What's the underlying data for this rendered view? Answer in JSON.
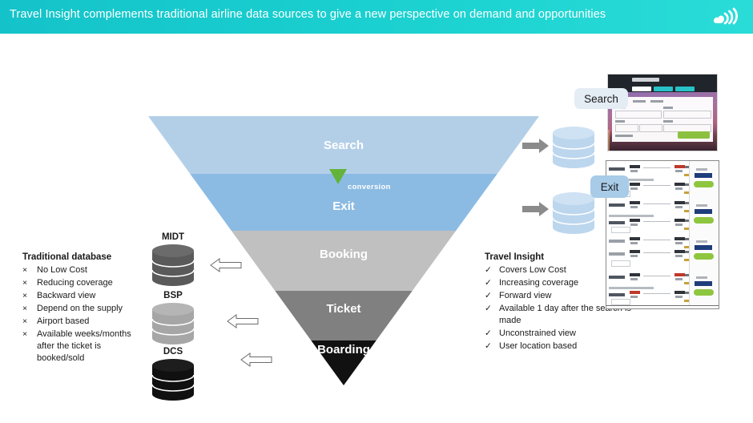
{
  "header": {
    "title": "Travel Insight complements traditional airline data sources to give a new perspective on demand and opportunities",
    "logo_icon": "skyscanner-cloud-wifi-logo",
    "bg_start": "#14c3c9",
    "bg_end": "#2adcd8"
  },
  "funnel": {
    "bands": [
      {
        "label": "Search",
        "color": "#b3cfe8"
      },
      {
        "label": "Exit",
        "color": "#8bbbe3"
      },
      {
        "label": "Booking",
        "color": "#c0c0c0"
      },
      {
        "label": "Ticket",
        "color": "#808080"
      },
      {
        "label": "Boarding",
        "color": "#111111"
      }
    ],
    "conversion_label": "conversion",
    "conversion_color": "#63b33b"
  },
  "left_panel": {
    "title": "Traditional database",
    "bullet_mark": "×",
    "items": [
      "No Low Cost",
      "Reducing coverage",
      "Backward view",
      "Depend on the supply",
      "Airport based",
      "Available weeks/months after the ticket is booked/sold"
    ]
  },
  "right_panel": {
    "title": "Travel Insight",
    "bullet_mark": "✓",
    "items": [
      "Covers Low Cost",
      "Increasing coverage",
      "Forward view",
      "Available 1 day after the search is made",
      "Unconstrained view",
      "User location based"
    ]
  },
  "databases": [
    {
      "label": "MIDT",
      "color": "#5a5a5a"
    },
    {
      "label": "BSP",
      "color": "#a6a6a6"
    },
    {
      "label": "DCS",
      "color": "#101010"
    }
  ],
  "insight_stores": [
    {
      "name": "search-data-store",
      "color": "#bcd6ee"
    },
    {
      "name": "exit-data-store",
      "color": "#bcd6ee"
    }
  ],
  "callouts": [
    {
      "label": "Search",
      "bg": "#e4ecf4"
    },
    {
      "label": "Exit",
      "bg": "#a8cbe8"
    }
  ],
  "mockups": {
    "search_screen": "skyscanner-flight-search-form",
    "results_screen": "skyscanner-flight-results-list"
  }
}
